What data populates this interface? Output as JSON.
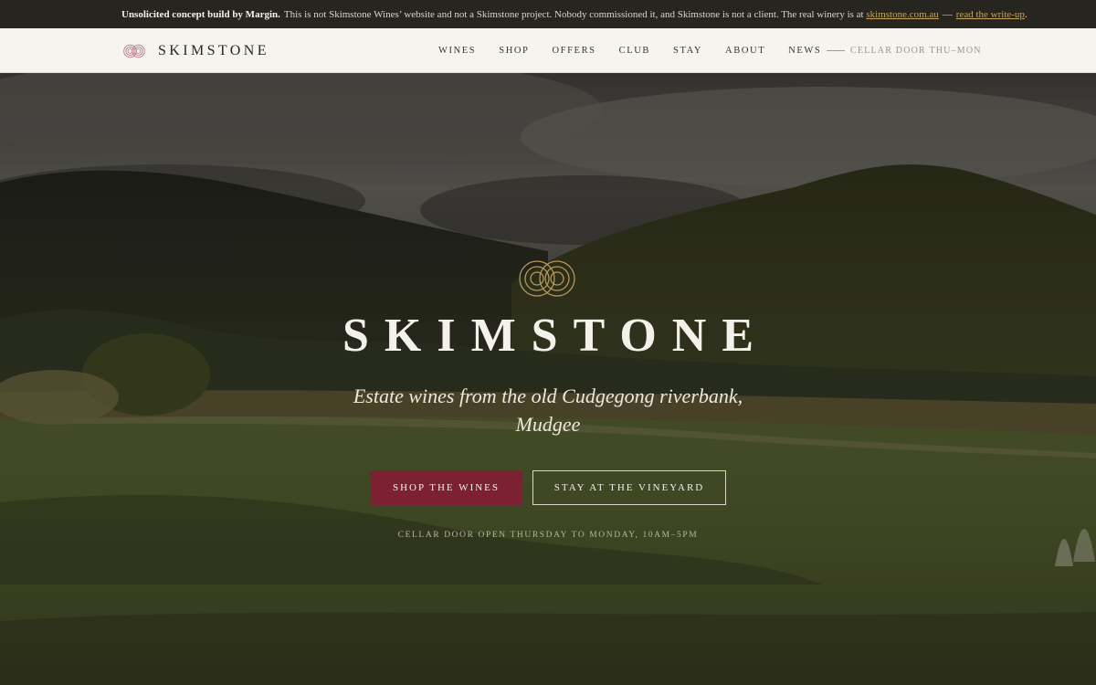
{
  "disclaimer": {
    "bold": "Unsolicited concept build by Margin.",
    "text": "This is not Skimstone Wines’ website and not a Skimstone project. Nobody commissioned it, and Skimstone is not a client. The real winery is at",
    "link": "skimstone.com.au",
    "separator": "—",
    "writeup": "read the write-up",
    "end": "."
  },
  "header": {
    "brand": "SKIMSTONE",
    "nav": [
      "WINES",
      "SHOP",
      "OFFERS",
      "CLUB",
      "STAY",
      "ABOUT",
      "NEWS"
    ],
    "cellar_note": "CELLAR DOOR THU–MON",
    "brand_icon": "double-ring-logo-icon"
  },
  "hero": {
    "title": "SKIMSTONE",
    "tagline": "Estate wines from the old Cudgegong riverbank, Mudgee",
    "primary_button": "SHOP THE WINES",
    "secondary_button": "STAY AT THE VINEYARD",
    "hours": "CELLAR DOOR OPEN THURSDAY TO MONDAY, 10AM–5PM",
    "logo_icon": "double-ring-logo-icon"
  },
  "colors": {
    "accent_gold": "#c9a45b",
    "wine_red": "#7c2131",
    "header_bg": "#f6f4ee",
    "disclaimer_bg": "#262520"
  }
}
